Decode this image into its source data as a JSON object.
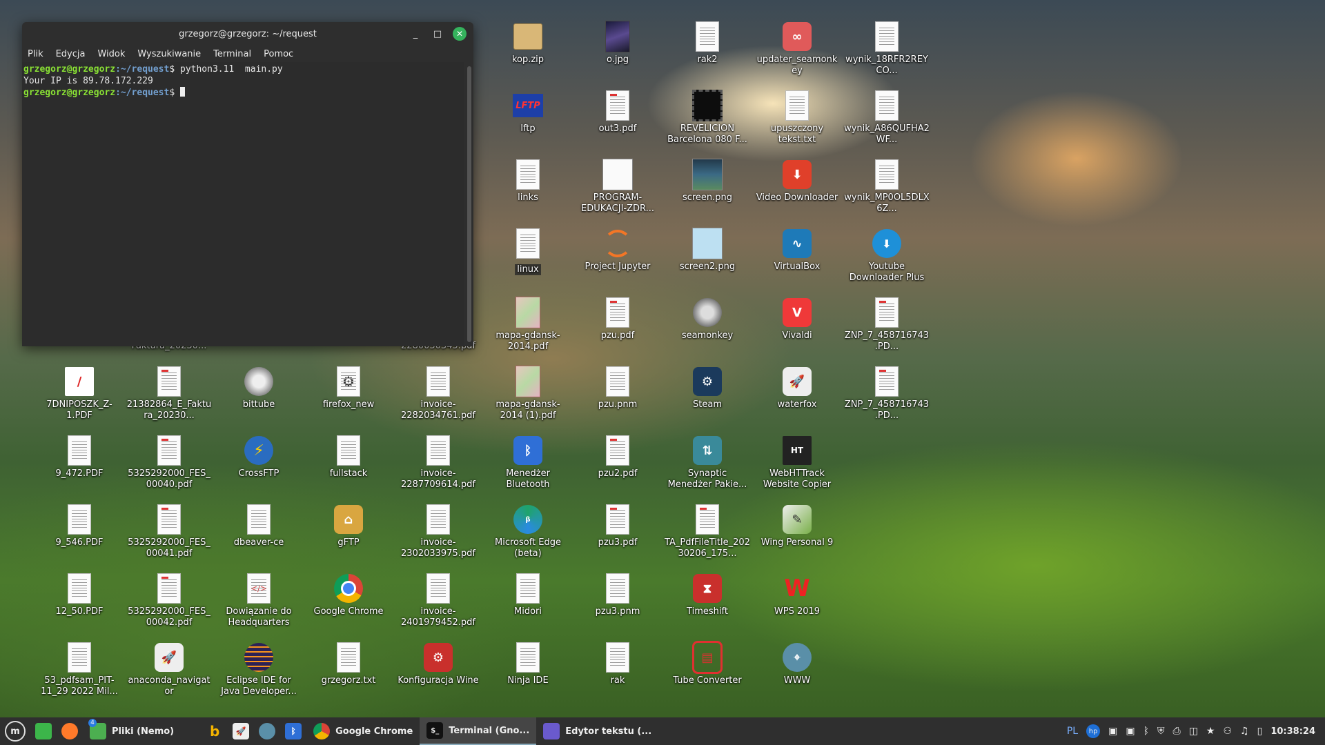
{
  "terminal": {
    "title": "grzegorz@grzegorz: ~/request",
    "menu": [
      "Plik",
      "Edycja",
      "Widok",
      "Wyszukiwanie",
      "Terminal",
      "Pomoc"
    ],
    "line1_prompt": "grzegorz@grzegorz",
    "line1_path": ":~/request",
    "line1_cmd": "$ python3.11  main.py",
    "line2_output": "Your IP is 89.78.172.229",
    "line3_prompt": "grzegorz@grzegorz",
    "line3_path": ":~/request",
    "line3_cmd": "$ "
  },
  "desktop_icons": {
    "kop_zip": "kop.zip",
    "o_jpg": "o.jpg",
    "rak2": "rak2",
    "updater": "updater_seamonkey",
    "wynik1": "wynik_18RFR2REYCO...",
    "lftp": "lftp",
    "out3": "out3.pdf",
    "revelicion": "REVELICION Barcelona 080 F...",
    "upuszczony": "upuszczony tekst.txt",
    "wynik2": "wynik_A86QUFHA2WF...",
    "links": "links",
    "program": "PROGRAM-EDUKACJI-ZDR...",
    "screen": "screen.png",
    "video_dl": "Video Downloader",
    "wynik3": "wynik_MP0OL5DLX6Z...",
    "linux": "linux",
    "jupyter": "Project Jupyter",
    "screen2": "screen2.png",
    "virtualbox": "VirtualBox",
    "youtube_dl": "Youtube Downloader Plus",
    "faktura_partial": "Faktura_20230...",
    "pdf_partial": "2280030345.pdf",
    "mapa1": "mapa-gdansk-2014.pdf",
    "pzu_pdf": "pzu.pdf",
    "seamonkey": "seamonkey",
    "vivaldi": "Vivaldi",
    "znp1": "ZNP_7_458716743.PD...",
    "dniposzk": "7DNIPOSZK_Z-1.PDF",
    "faktura": "21382864_E_Faktura_20230...",
    "bittube": "bittube",
    "firefox_new": "firefox_new",
    "invoice1": "invoice-2282034761.pdf",
    "mapa2": "mapa-gdansk-2014 (1).pdf",
    "pzu_pnm": "pzu.pnm",
    "steam": "Steam",
    "waterfox": "waterfox",
    "znp2": "ZNP_7_458716743.PD...",
    "f9_472": "9_472.PDF",
    "fes40": "5325292000_FES_00040.pdf",
    "crossftp": "CrossFTP",
    "fullstack": "fullstack",
    "invoice2": "invoice-2287709614.pdf",
    "bluetooth": "Menedżer Bluetooth",
    "pzu2": "pzu2.pdf",
    "synaptic": "Synaptic Menedżer Pakie...",
    "httrack": "WebHTTrack Website Copier",
    "f9_546": "9_546.PDF",
    "fes41": "5325292000_FES_00041.pdf",
    "dbeaver": "dbeaver-ce",
    "gftp": "gFTP",
    "invoice3": "invoice-2302033975.pdf",
    "edge": "Microsoft Edge (beta)",
    "pzu3": "pzu3.pdf",
    "ta_pdf": "TA_PdfFileTitle_20230206_175...",
    "wing": "Wing Personal 9",
    "f12_50": "12_50.PDF",
    "fes42": "5325292000_FES_00042.pdf",
    "dowiazanie": "Dowiązanie do Headquarters",
    "chrome": "Google Chrome",
    "invoice4": "invoice-2401979452.pdf",
    "midori": "Midori",
    "pzu3_pnm": "pzu3.pnm",
    "timeshift": "Timeshift",
    "wps": "WPS 2019",
    "pdfsam": "53_pdfsam_PIT-11_29 2022 Mil...",
    "anaconda": "anaconda_navigator",
    "eclipse": "Eclipse IDE for Java Developer...",
    "grzegorz_txt": "grzegorz.txt",
    "wine": "Konfiguracja Wine",
    "ninja": "Ninja IDE",
    "rak": "rak",
    "tube": "Tube Converter",
    "www": "WWW"
  },
  "taskbar": {
    "files_badge": "4",
    "files": "Pliki (Nemo)",
    "chrome": "Google Chrome",
    "terminal": "Terminal (Gno...",
    "editor": "Edytor tekstu (...",
    "lang": "PL",
    "clock": "10:38:24"
  },
  "icons": {
    "menu": "mint-menu-icon",
    "show_desktop": "show-desktop-icon",
    "firefox": "firefox-icon"
  },
  "colors": {
    "terminal_bg": "#2e2e2e",
    "prompt_green": "#8ae234",
    "path_blue": "#729fcf",
    "close_green": "#35b35d",
    "taskbar": "#2f2f2f"
  }
}
